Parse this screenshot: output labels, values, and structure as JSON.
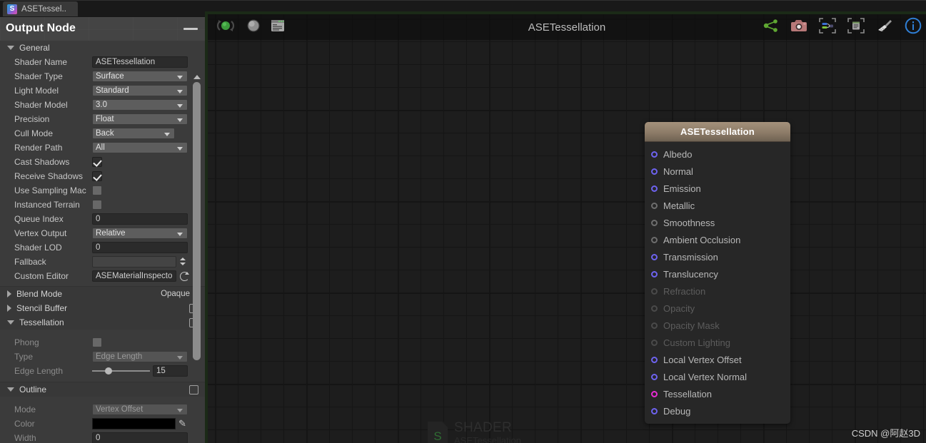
{
  "window": {
    "tab": {
      "label": "ASETessel..",
      "icon": "shader-file-icon"
    }
  },
  "inspector": {
    "title": "Output Node",
    "collapse_icon": "minimize-icon",
    "sections": [
      {
        "id": "general",
        "label": "General",
        "expanded": true
      },
      {
        "id": "blend_mode",
        "label": "Blend Mode",
        "expanded": false,
        "value": "Opaque"
      },
      {
        "id": "stencil_buffer",
        "label": "Stencil Buffer",
        "expanded": false,
        "checked": false
      },
      {
        "id": "tessellation",
        "label": "Tessellation",
        "expanded": true,
        "checked": false
      },
      {
        "id": "outline",
        "label": "Outline",
        "expanded": true,
        "checked": false
      }
    ],
    "general_rows": [
      {
        "label": "Shader Name",
        "control": "text",
        "value": "ASETessellation"
      },
      {
        "label": "Shader Type",
        "control": "popup",
        "value": "Surface"
      },
      {
        "label": "Light Model",
        "control": "popup",
        "value": "Standard"
      },
      {
        "label": "Shader Model",
        "control": "popup",
        "value": "3.0"
      },
      {
        "label": "Precision",
        "control": "popup",
        "value": "Float"
      },
      {
        "label": "Cull Mode",
        "control": "popup-dot",
        "value": "Back"
      },
      {
        "label": "Render Path",
        "control": "popup",
        "value": "All"
      },
      {
        "label": "Cast Shadows",
        "control": "checkbox",
        "value": "on"
      },
      {
        "label": "Receive Shadows",
        "control": "checkbox",
        "value": "on"
      },
      {
        "label": "Use Sampling Mac",
        "control": "checkbox",
        "value": "off"
      },
      {
        "label": "Instanced Terrain",
        "control": "checkbox",
        "value": "off"
      },
      {
        "label": "Queue Index",
        "control": "text",
        "value": "0"
      },
      {
        "label": "Vertex Output",
        "control": "popup",
        "value": "Relative"
      },
      {
        "label": "Shader LOD",
        "control": "text",
        "value": "0"
      },
      {
        "label": "Fallback",
        "control": "text-spinner",
        "value": ""
      },
      {
        "label": "Custom Editor",
        "control": "text-reload",
        "value": "ASEMaterialInspecto"
      }
    ],
    "tessellation_rows": [
      {
        "label": "Phong",
        "control": "checkbox",
        "value": "off"
      },
      {
        "label": "Type",
        "control": "popup",
        "value": "Edge Length"
      },
      {
        "label": "Edge Length",
        "control": "slider",
        "value": "15"
      }
    ],
    "outline_rows": [
      {
        "label": "Mode",
        "control": "popup",
        "value": "Vertex Offset"
      },
      {
        "label": "Color",
        "control": "color",
        "value": "#000000"
      },
      {
        "label": "Width",
        "control": "text",
        "value": "0"
      }
    ]
  },
  "graph": {
    "title": "ASETessellation",
    "toolbar_left": [
      {
        "name": "live-preview-toggle",
        "icon": "refresh-circle-green-icon"
      },
      {
        "name": "preview-sphere-toggle",
        "icon": "sphere-icon"
      },
      {
        "name": "console-toggle",
        "icon": "console-window-icon"
      }
    ],
    "toolbar_right": [
      {
        "name": "share-button",
        "icon": "share-icon",
        "color": "#5fa832"
      },
      {
        "name": "take-screenshot-button",
        "icon": "camera-icon",
        "color": "#c37878"
      },
      {
        "name": "focus-selection-button",
        "icon": "focus-node-icon"
      },
      {
        "name": "focus-master-node-button",
        "icon": "focus-list-icon"
      },
      {
        "name": "cleanup-button",
        "icon": "broom-icon"
      },
      {
        "name": "info-button",
        "icon": "info-circle-icon",
        "color": "#2f7fd6"
      }
    ],
    "watermark": {
      "title": "SHADER",
      "subtitle": "ASETessellation",
      "icon_letter": "S"
    },
    "credit": "CSDN @阿赵3D",
    "update_icon": {
      "name": "update-shader-icon",
      "color": "#e2df2b"
    }
  },
  "node": {
    "title": "ASETessellation",
    "ports": [
      {
        "label": "Albedo",
        "state": "active",
        "color": "#6e63f0"
      },
      {
        "label": "Normal",
        "state": "active",
        "color": "#6e63f0"
      },
      {
        "label": "Emission",
        "state": "active",
        "color": "#6e63f0"
      },
      {
        "label": "Metallic",
        "state": "gray",
        "color": "#6e6e6e"
      },
      {
        "label": "Smoothness",
        "state": "gray",
        "color": "#6e6e6e"
      },
      {
        "label": "Ambient Occlusion",
        "state": "gray",
        "color": "#6e6e6e"
      },
      {
        "label": "Transmission",
        "state": "active",
        "color": "#6e63f0"
      },
      {
        "label": "Translucency",
        "state": "active",
        "color": "#6e63f0"
      },
      {
        "label": "Refraction",
        "state": "disabled",
        "color": "#4a4a4a"
      },
      {
        "label": "Opacity",
        "state": "disabled",
        "color": "#4a4a4a"
      },
      {
        "label": "Opacity Mask",
        "state": "disabled",
        "color": "#4a4a4a"
      },
      {
        "label": "Custom Lighting",
        "state": "disabled",
        "color": "#4a4a4a"
      },
      {
        "label": "Local Vertex Offset",
        "state": "active",
        "color": "#6e63f0"
      },
      {
        "label": "Local Vertex Normal",
        "state": "active",
        "color": "#6e63f0"
      },
      {
        "label": "Tessellation",
        "state": "magenta",
        "color": "#e92bd4"
      },
      {
        "label": "Debug",
        "state": "active",
        "color": "#6e63f0"
      }
    ]
  }
}
